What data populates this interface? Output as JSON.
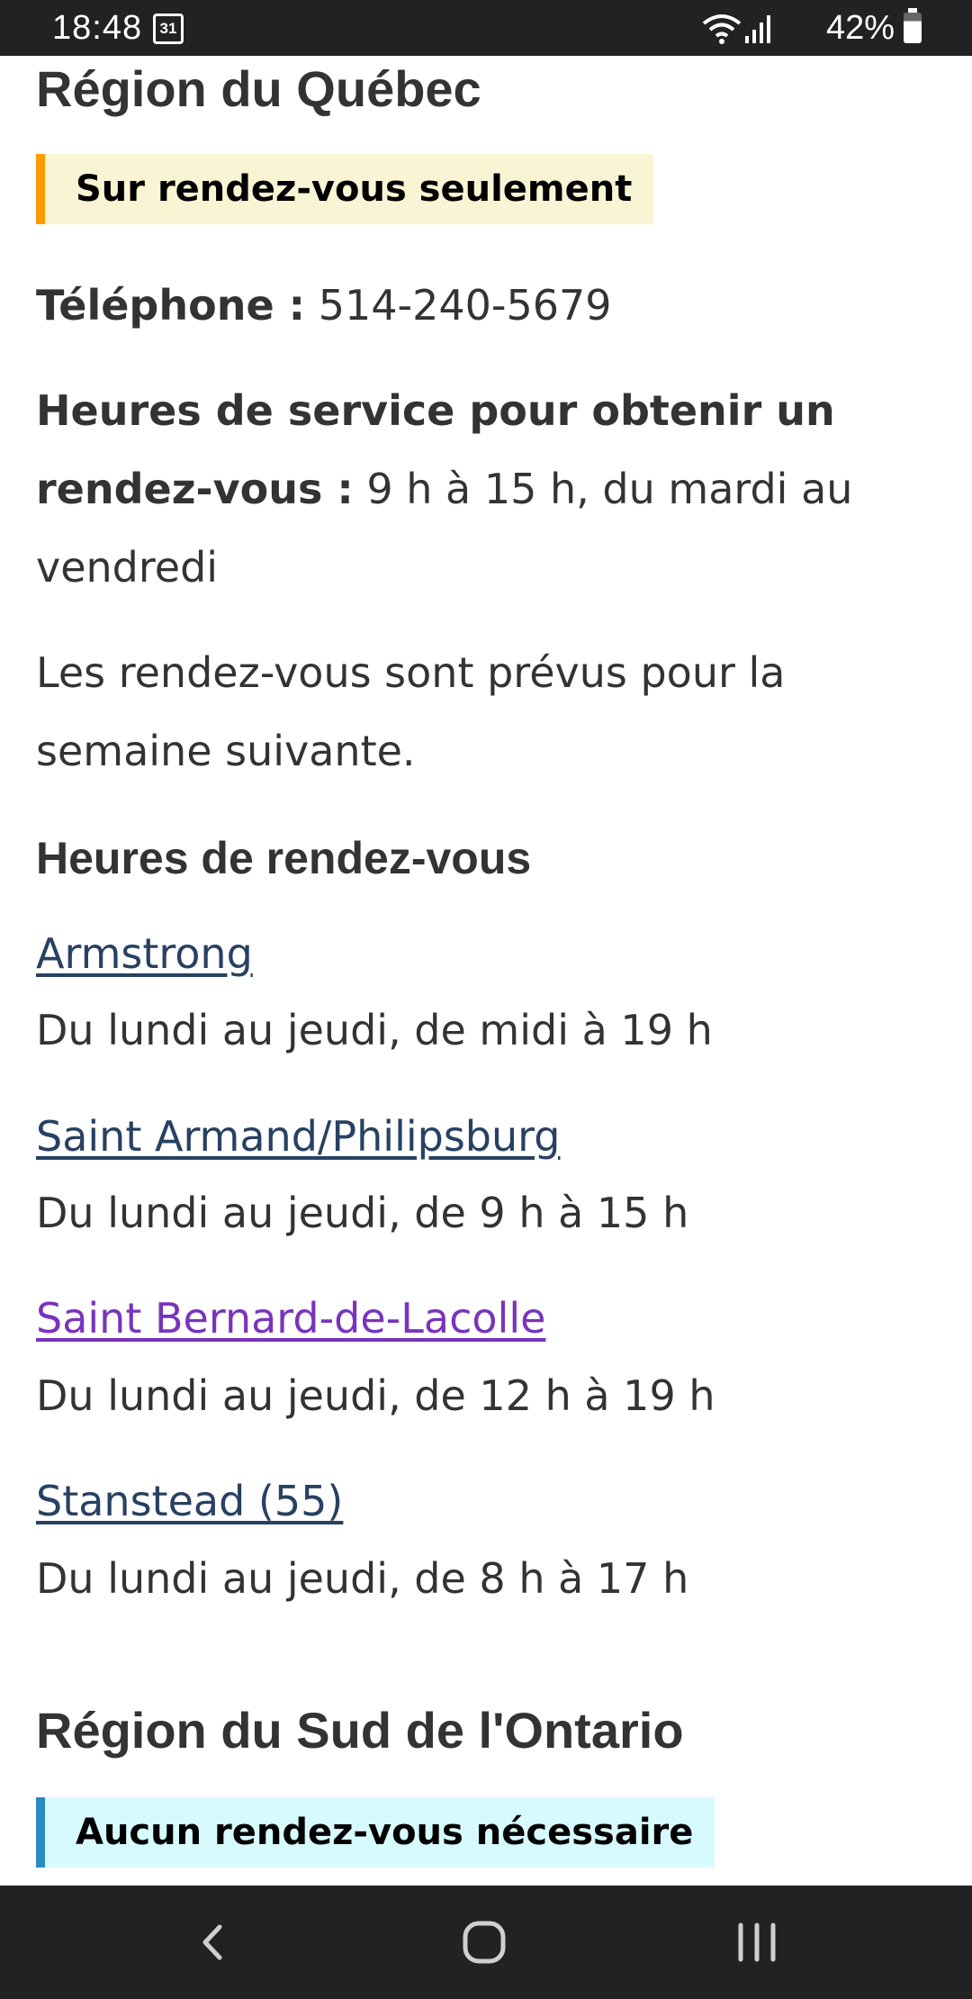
{
  "status_bar": {
    "time": "18:48",
    "calendar_day": "31",
    "battery": "42%"
  },
  "quebec": {
    "heading": "Région du Québec",
    "badge": "Sur rendez-vous seulement",
    "phone_label": "Téléphone :",
    "phone_value": "514-240-5679",
    "service_hours_label": "Heures de service pour obtenir un rendez-vous :",
    "service_hours_value": "9 h à 15 h, du mardi au vendredi",
    "note": "Les rendez-vous sont prévus pour la semaine suivante.",
    "appointments_heading": "Heures de rendez-vous",
    "offices": [
      {
        "name": "Armstrong",
        "hours": "Du lundi au jeudi, de midi à 19 h"
      },
      {
        "name": "Saint Armand/Philipsburg",
        "hours": "Du lundi au jeudi, de 9 h à 15 h"
      },
      {
        "name": "Saint Bernard-de-Lacolle",
        "hours": "Du lundi au jeudi, de 12 h à 19 h"
      },
      {
        "name": "Stanstead (55)",
        "hours": "Du lundi au jeudi, de 8 h à 17 h"
      }
    ]
  },
  "ontario": {
    "heading": "Région du Sud de l'Ontario",
    "badge": "Aucun rendez-vous nécessaire"
  },
  "colors": {
    "link": "#284162",
    "link_visited": "#7834bc",
    "warning_accent": "#ff9900",
    "info_accent": "#2b8cc4"
  }
}
